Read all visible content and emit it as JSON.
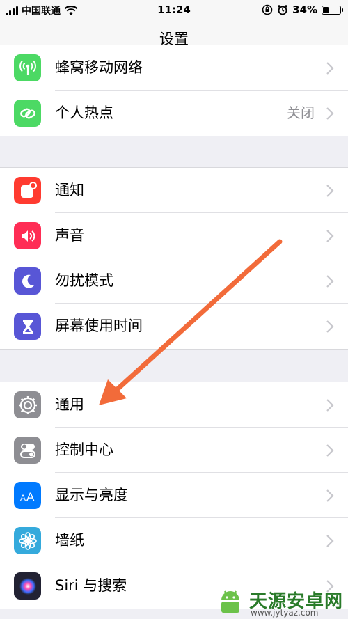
{
  "status_bar": {
    "carrier": "中国联通",
    "time": "11:24",
    "battery_percent": "34%",
    "battery_level": 0.34
  },
  "nav": {
    "title": "设置"
  },
  "groups": [
    {
      "rows": [
        {
          "label": "蜂窝移动网络",
          "icon": "cellular-antenna-icon",
          "color": "#4cd964"
        },
        {
          "label": "个人热点",
          "value": "关闭",
          "icon": "hotspot-link-icon",
          "color": "#4cd964"
        }
      ]
    },
    {
      "rows": [
        {
          "label": "通知",
          "icon": "notifications-icon",
          "color": "#ff3b30"
        },
        {
          "label": "声音",
          "icon": "speaker-icon",
          "color": "#ff2d55"
        },
        {
          "label": "勿扰模式",
          "icon": "moon-icon",
          "color": "#5856d6"
        },
        {
          "label": "屏幕使用时间",
          "icon": "hourglass-icon",
          "color": "#5856d6"
        }
      ]
    },
    {
      "rows": [
        {
          "label": "通用",
          "icon": "gear-icon",
          "color": "#8e8e93"
        },
        {
          "label": "控制中心",
          "icon": "toggles-icon",
          "color": "#8e8e93"
        },
        {
          "label": "显示与亮度",
          "icon": "text-size-icon",
          "color": "#007aff"
        },
        {
          "label": "墙纸",
          "icon": "flower-icon",
          "color": "#35aadc"
        },
        {
          "label": "Siri 与搜索",
          "icon": "siri-icon",
          "color": "#222233"
        }
      ]
    }
  ],
  "annotation": {
    "arrow_color": "#f26b3a"
  },
  "watermark": {
    "text": "天源安卓网",
    "url": "www.jytyaz.com"
  }
}
